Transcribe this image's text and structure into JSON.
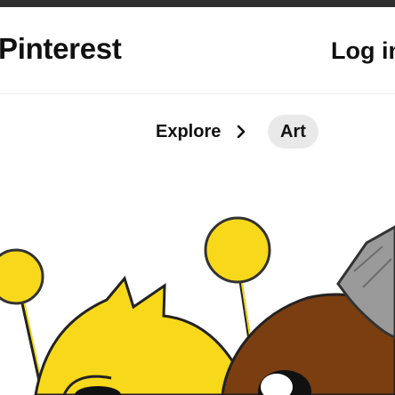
{
  "header": {
    "brand": "Pinterest",
    "login_label": "Log in"
  },
  "breadcrumb": {
    "items": [
      {
        "label": "Explore"
      },
      {
        "label": "Art"
      }
    ],
    "separator_icon": "chevron-right-icon"
  },
  "pin": {
    "image": "cartoon-characters-artwork"
  },
  "colors": {
    "text": "#111111",
    "pill_bg": "#e9e9e9",
    "top_strip": "#2f2f2f",
    "yellow": "#f7d81b",
    "brown": "#7a3e10"
  }
}
